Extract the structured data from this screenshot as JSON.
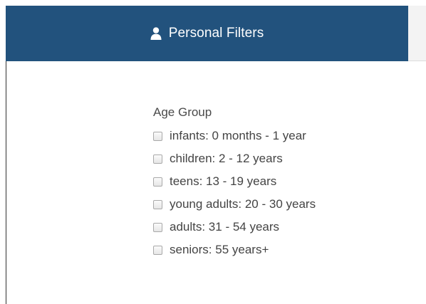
{
  "tabs": {
    "active": {
      "icon": "user-icon",
      "label": "Personal Filters"
    }
  },
  "filters": {
    "age_group": {
      "title": "Age Group",
      "options": [
        {
          "label": "infants: 0 months - 1 year",
          "checked": false
        },
        {
          "label": "children: 2 - 12 years",
          "checked": false
        },
        {
          "label": "teens: 13 - 19 years",
          "checked": false
        },
        {
          "label": "young adults: 20 - 30 years",
          "checked": false
        },
        {
          "label": "adults: 31 - 54 years",
          "checked": false
        },
        {
          "label": "seniors: 55 years+",
          "checked": false
        }
      ]
    }
  },
  "colors": {
    "tab_active_bg": "#22527d",
    "tab_active_text": "#ffffff",
    "tab_inactive_bg": "#f3f3f3",
    "text": "#444444"
  }
}
